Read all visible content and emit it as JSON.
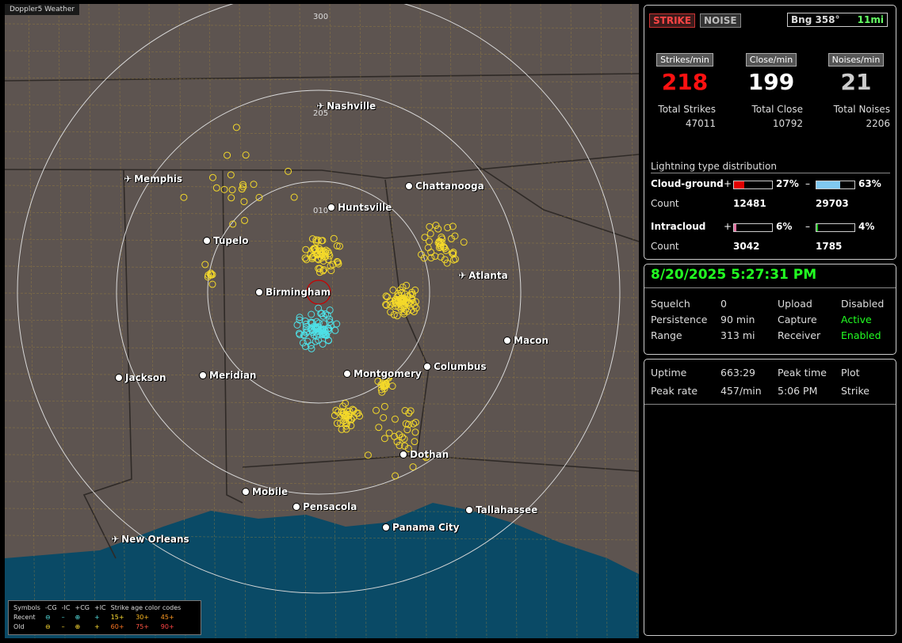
{
  "app_title": "Doppler5 Weather",
  "ring_labels": [
    "300",
    "205",
    "010"
  ],
  "cities": [
    {
      "name": "Nashville",
      "type": "plane"
    },
    {
      "name": "Memphis",
      "type": "plane"
    },
    {
      "name": "Chattanooga",
      "type": "dot"
    },
    {
      "name": "Huntsville",
      "type": "dot"
    },
    {
      "name": "Tupelo",
      "type": "dot"
    },
    {
      "name": "Atlanta",
      "type": "plane"
    },
    {
      "name": "Birmingham",
      "type": "dot"
    },
    {
      "name": "Macon",
      "type": "dot"
    },
    {
      "name": "Jackson",
      "type": "dot"
    },
    {
      "name": "Meridian",
      "type": "dot"
    },
    {
      "name": "Montgomery",
      "type": "dot"
    },
    {
      "name": "Columbus",
      "type": "dot"
    },
    {
      "name": "Dothan",
      "type": "dot"
    },
    {
      "name": "Mobile",
      "type": "dot"
    },
    {
      "name": "Pensacola",
      "type": "dot"
    },
    {
      "name": "Tallahassee",
      "type": "dot"
    },
    {
      "name": "Panama City",
      "type": "dot"
    },
    {
      "name": "New Orleans",
      "type": "plane"
    }
  ],
  "legend": {
    "symbols_label": "Symbols",
    "cols": [
      "-CG",
      "-IC",
      "+CG",
      "+IC"
    ],
    "recent_label": "Recent",
    "old_label": "Old",
    "age_title": "Strike age color codes",
    "recent_ages": [
      "15+",
      "30+",
      "45+"
    ],
    "old_ages": [
      "60+",
      "75+",
      "90+"
    ]
  },
  "status": {
    "strike_button": "STRIKE",
    "noise_button": "NOISE",
    "bearing": "Bng 358°",
    "bearing_range": "11mi",
    "strikes_per_min_label": "Strikes/min",
    "strikes_per_min": "218",
    "close_per_min_label": "Close/min",
    "close_per_min": "199",
    "noises_per_min_label": "Noises/min",
    "noises_per_min": "21",
    "total_strikes_label": "Total Strikes",
    "total_strikes": "47011",
    "total_close_label": "Total Close",
    "total_close": "10792",
    "total_noises_label": "Total Noises",
    "total_noises": "2206",
    "distribution_title": "Lightning type distribution",
    "cg_label": "Cloud-ground",
    "cg_pos_pct": "27%",
    "cg_neg_pct": "63%",
    "count_label": "Count",
    "cg_pos_count": "12481",
    "cg_neg_count": "29703",
    "ic_label": "Intracloud",
    "ic_pos_pct": "6%",
    "ic_neg_pct": "4%",
    "ic_pos_count": "3042",
    "ic_neg_count": "1785",
    "plus": "+",
    "minus": "–",
    "cg_pos_fill": 0.27,
    "cg_neg_fill": 0.63,
    "ic_pos_fill": 0.06,
    "ic_neg_fill": 0.04,
    "colors": {
      "cg_pos": "#e00000",
      "cg_neg": "#80c8f0",
      "ic_pos": "#e070a0",
      "ic_neg": "#20c020"
    }
  },
  "settings": {
    "datetime": "8/20/2025 5:27:31 PM",
    "squelch_label": "Squelch",
    "squelch": "0",
    "persistence_label": "Persistence",
    "persistence": "90 min",
    "range_label": "Range",
    "range": "313 mi",
    "upload_label": "Upload",
    "upload": "Disabled",
    "capture_label": "Capture",
    "capture": "Active",
    "receiver_label": "Receiver",
    "receiver": "Enabled"
  },
  "uptime": {
    "uptime_label": "Uptime",
    "uptime": "663:29",
    "peak_time_label": "Peak time",
    "peak_time": "5:06 PM",
    "plot_label": "Plot",
    "plot": "Strike",
    "peak_rate_label": "Peak rate",
    "peak_rate": "457/min"
  }
}
